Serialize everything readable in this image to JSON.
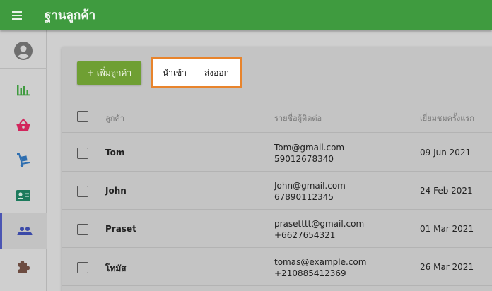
{
  "app": {
    "title": "ฐานลูกค้า"
  },
  "sidebar": {
    "items": [
      {
        "icon": "account-circle-icon"
      },
      {
        "icon": "bar-chart-icon"
      },
      {
        "icon": "basket-icon"
      },
      {
        "icon": "hand-truck-icon"
      },
      {
        "icon": "contact-card-icon"
      },
      {
        "icon": "people-icon",
        "active": true
      },
      {
        "icon": "puzzle-icon"
      }
    ]
  },
  "toolbar": {
    "add_label": "+ เพิ่มลูกค้า",
    "import_label": "นำเข้า",
    "export_label": "ส่งออก"
  },
  "table": {
    "headers": {
      "customer": "ลูกค้า",
      "contact": "รายชื่อผู้ติดต่อ",
      "first_visit": "เยี่ยมชมครั้งแรก"
    },
    "rows": [
      {
        "name": "Tom",
        "email": "Tom@gmail.com",
        "phone": "59012678340",
        "date": "09 Jun 2021"
      },
      {
        "name": "John",
        "email": "John@gmail.com",
        "phone": "67890112345",
        "date": "24 Feb 2021"
      },
      {
        "name": "Praset",
        "email": "prasetttt@gmail.com",
        "phone": "+6627654321",
        "date": "01 Mar 2021"
      },
      {
        "name": "โทมัส",
        "email": "tomas@example.com",
        "phone": "+210885412369",
        "date": "26 Mar 2021"
      }
    ]
  },
  "colors": {
    "appbar": "#3f9b3f",
    "add_button": "#6f9f33",
    "highlight_border": "#e8842c",
    "active_indicator": "#4b55b3"
  }
}
